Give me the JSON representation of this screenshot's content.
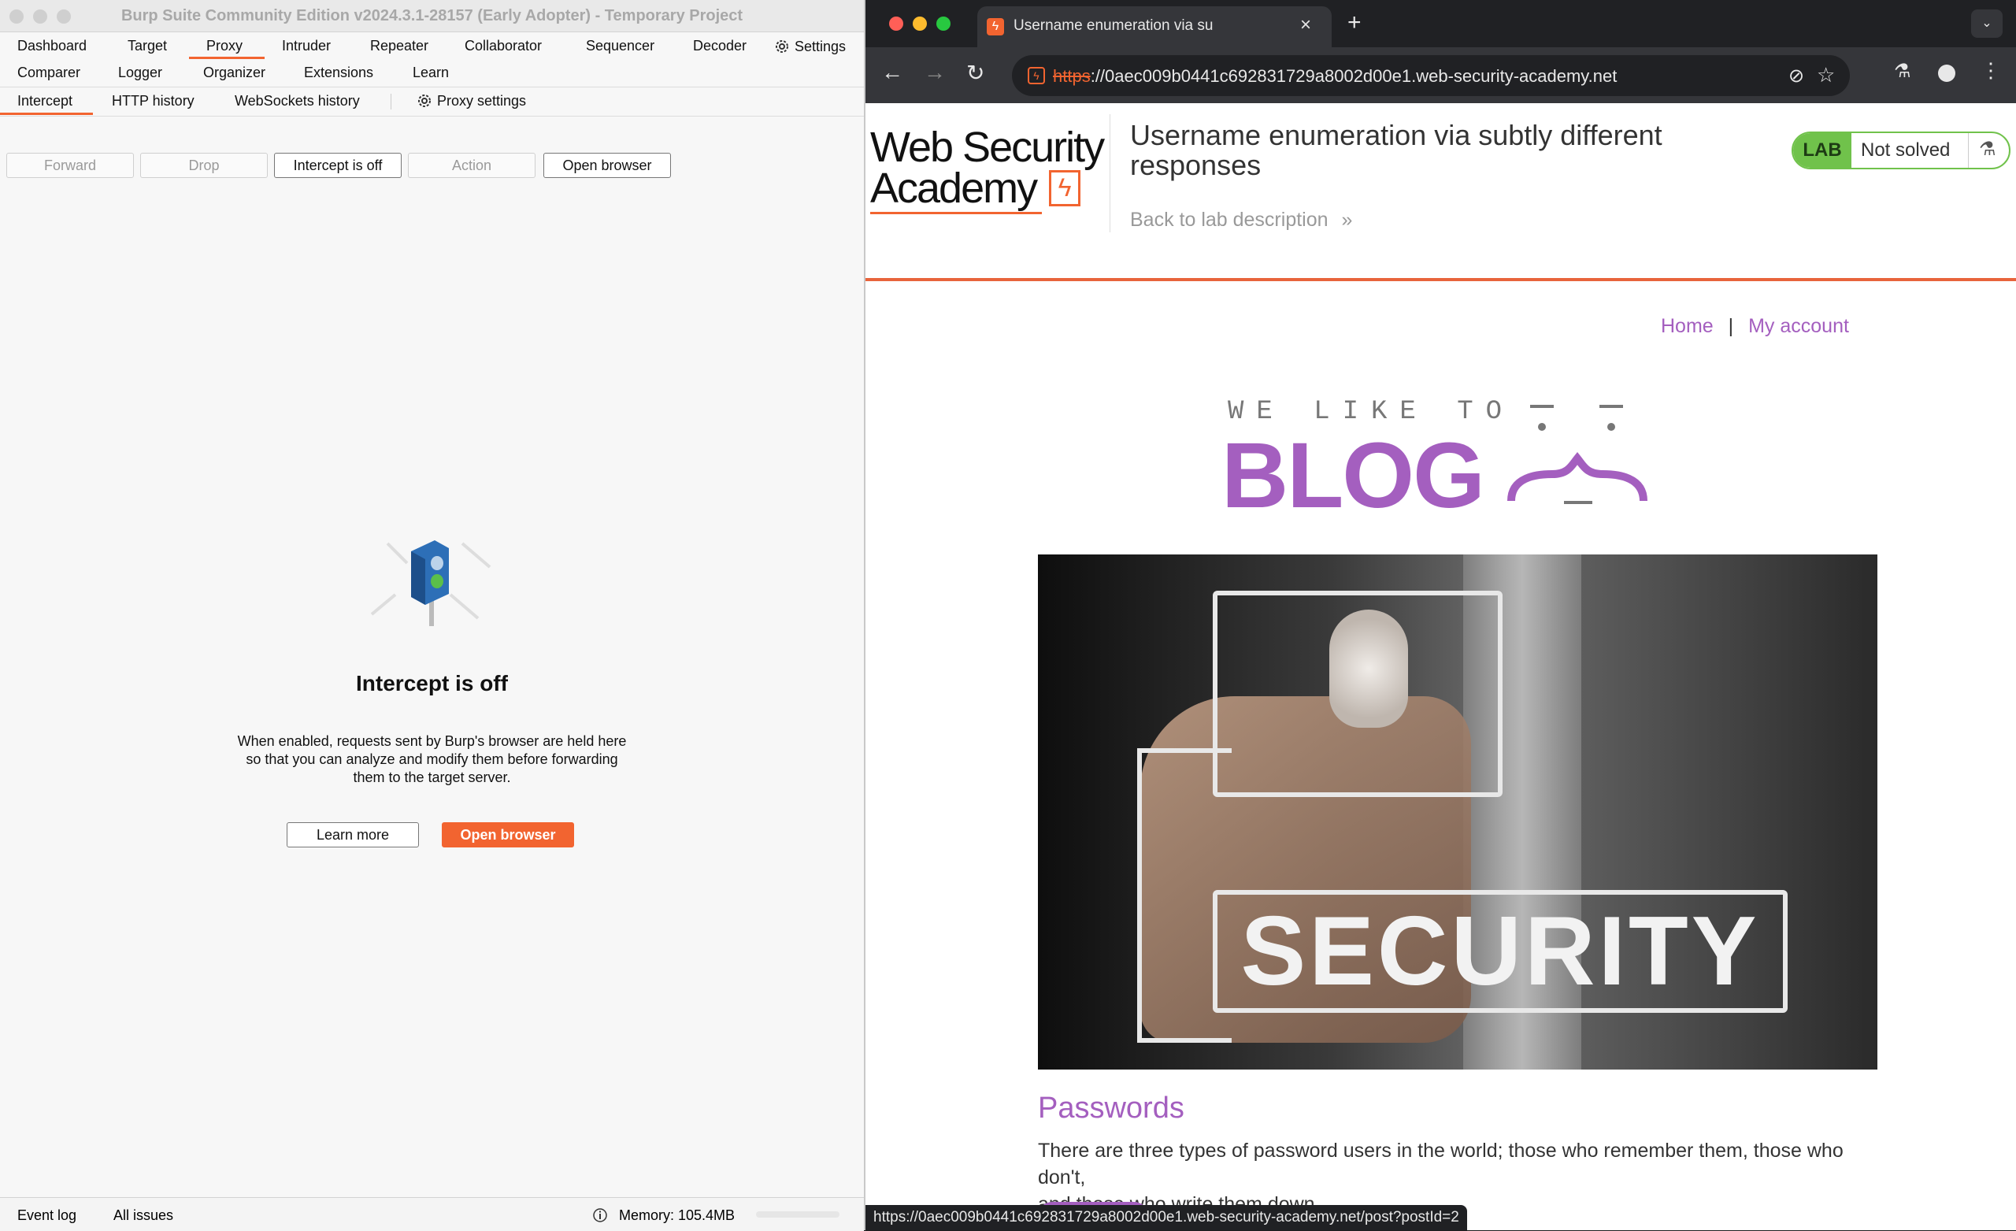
{
  "burp": {
    "window_title": "Burp Suite Community Edition v2024.3.1-28157 (Early Adopter) - Temporary Project",
    "main_tabs_row1": [
      "Dashboard",
      "Target",
      "Proxy",
      "Intruder",
      "Repeater",
      "Collaborator",
      "Sequencer",
      "Decoder"
    ],
    "settings_label": "Settings",
    "main_tabs_row2": [
      "Comparer",
      "Logger",
      "Organizer",
      "Extensions",
      "Learn"
    ],
    "active_main_tab": "Proxy",
    "sub_tabs": [
      "Intercept",
      "HTTP history",
      "WebSockets history"
    ],
    "proxy_settings_label": "Proxy settings",
    "active_sub_tab": "Intercept",
    "toolbar": {
      "forward": "Forward",
      "drop": "Drop",
      "intercept_toggle": "Intercept is off",
      "action": "Action",
      "open_browser": "Open browser"
    },
    "empty_state": {
      "heading": "Intercept is off",
      "line1": "When enabled, requests sent by Burp's browser are held here",
      "line2": "so that you can analyze and modify them before forwarding",
      "line3": "them to the target server.",
      "learn_more": "Learn more",
      "open_browser": "Open browser"
    },
    "statusbar": {
      "event_log": "Event log",
      "all_issues": "All issues",
      "memory": "Memory: 105.4MB"
    }
  },
  "browser": {
    "tab_title": "Username enumeration via su",
    "url_scheme": "https",
    "url_rest": "://0aec009b0441c692831729a8002d00e1.web-security-academy.net",
    "status_url": "https://0aec009b0441c692831729a8002d00e1.web-security-academy.net/post?postId=2"
  },
  "academy": {
    "logo_line1": "Web Security",
    "logo_line2": "Academy",
    "lab_title_line1": "Username enumeration via subtly different",
    "lab_title_line2": "responses",
    "back_link": "Back to lab description",
    "lab_badge": "LAB",
    "lab_status": "Not solved",
    "nav_home": "Home",
    "nav_separator": "|",
    "nav_account": "My account",
    "blog_tagline": "WE LIKE TO",
    "blog_word": "BLOG",
    "hero_text": "SECURITY",
    "post_title": "Passwords",
    "post_line1": "There are three types of password users in the world; those who remember them, those who don't,",
    "post_line2": "and those who write them down."
  },
  "colors": {
    "accent": "#f26430",
    "academy_purple": "#a45fbf",
    "lab_green": "#70c24b"
  }
}
